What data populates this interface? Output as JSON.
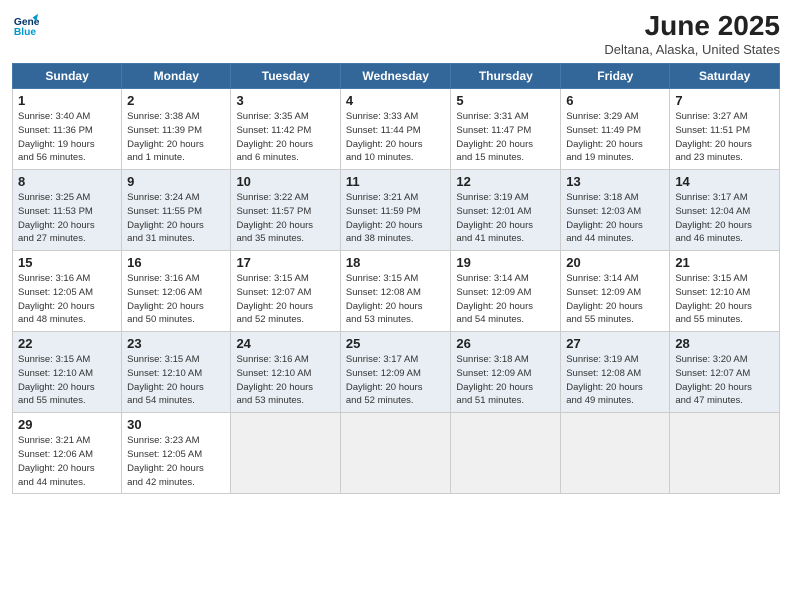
{
  "header": {
    "logo_line1": "General",
    "logo_line2": "Blue",
    "month": "June 2025",
    "location": "Deltana, Alaska, United States"
  },
  "days_of_week": [
    "Sunday",
    "Monday",
    "Tuesday",
    "Wednesday",
    "Thursday",
    "Friday",
    "Saturday"
  ],
  "weeks": [
    [
      {
        "day": "1",
        "info": "Sunrise: 3:40 AM\nSunset: 11:36 PM\nDaylight: 19 hours\nand 56 minutes."
      },
      {
        "day": "2",
        "info": "Sunrise: 3:38 AM\nSunset: 11:39 PM\nDaylight: 20 hours\nand 1 minute."
      },
      {
        "day": "3",
        "info": "Sunrise: 3:35 AM\nSunset: 11:42 PM\nDaylight: 20 hours\nand 6 minutes."
      },
      {
        "day": "4",
        "info": "Sunrise: 3:33 AM\nSunset: 11:44 PM\nDaylight: 20 hours\nand 10 minutes."
      },
      {
        "day": "5",
        "info": "Sunrise: 3:31 AM\nSunset: 11:47 PM\nDaylight: 20 hours\nand 15 minutes."
      },
      {
        "day": "6",
        "info": "Sunrise: 3:29 AM\nSunset: 11:49 PM\nDaylight: 20 hours\nand 19 minutes."
      },
      {
        "day": "7",
        "info": "Sunrise: 3:27 AM\nSunset: 11:51 PM\nDaylight: 20 hours\nand 23 minutes."
      }
    ],
    [
      {
        "day": "8",
        "info": "Sunrise: 3:25 AM\nSunset: 11:53 PM\nDaylight: 20 hours\nand 27 minutes."
      },
      {
        "day": "9",
        "info": "Sunrise: 3:24 AM\nSunset: 11:55 PM\nDaylight: 20 hours\nand 31 minutes."
      },
      {
        "day": "10",
        "info": "Sunrise: 3:22 AM\nSunset: 11:57 PM\nDaylight: 20 hours\nand 35 minutes."
      },
      {
        "day": "11",
        "info": "Sunrise: 3:21 AM\nSunset: 11:59 PM\nDaylight: 20 hours\nand 38 minutes."
      },
      {
        "day": "12",
        "info": "Sunrise: 3:19 AM\nSunset: 12:01 AM\nDaylight: 20 hours\nand 41 minutes."
      },
      {
        "day": "13",
        "info": "Sunrise: 3:18 AM\nSunset: 12:03 AM\nDaylight: 20 hours\nand 44 minutes."
      },
      {
        "day": "14",
        "info": "Sunrise: 3:17 AM\nSunset: 12:04 AM\nDaylight: 20 hours\nand 46 minutes."
      }
    ],
    [
      {
        "day": "15",
        "info": "Sunrise: 3:16 AM\nSunset: 12:05 AM\nDaylight: 20 hours\nand 48 minutes."
      },
      {
        "day": "16",
        "info": "Sunrise: 3:16 AM\nSunset: 12:06 AM\nDaylight: 20 hours\nand 50 minutes."
      },
      {
        "day": "17",
        "info": "Sunrise: 3:15 AM\nSunset: 12:07 AM\nDaylight: 20 hours\nand 52 minutes."
      },
      {
        "day": "18",
        "info": "Sunrise: 3:15 AM\nSunset: 12:08 AM\nDaylight: 20 hours\nand 53 minutes."
      },
      {
        "day": "19",
        "info": "Sunrise: 3:14 AM\nSunset: 12:09 AM\nDaylight: 20 hours\nand 54 minutes."
      },
      {
        "day": "20",
        "info": "Sunrise: 3:14 AM\nSunset: 12:09 AM\nDaylight: 20 hours\nand 55 minutes."
      },
      {
        "day": "21",
        "info": "Sunrise: 3:15 AM\nSunset: 12:10 AM\nDaylight: 20 hours\nand 55 minutes."
      }
    ],
    [
      {
        "day": "22",
        "info": "Sunrise: 3:15 AM\nSunset: 12:10 AM\nDaylight: 20 hours\nand 55 minutes."
      },
      {
        "day": "23",
        "info": "Sunrise: 3:15 AM\nSunset: 12:10 AM\nDaylight: 20 hours\nand 54 minutes."
      },
      {
        "day": "24",
        "info": "Sunrise: 3:16 AM\nSunset: 12:10 AM\nDaylight: 20 hours\nand 53 minutes."
      },
      {
        "day": "25",
        "info": "Sunrise: 3:17 AM\nSunset: 12:09 AM\nDaylight: 20 hours\nand 52 minutes."
      },
      {
        "day": "26",
        "info": "Sunrise: 3:18 AM\nSunset: 12:09 AM\nDaylight: 20 hours\nand 51 minutes."
      },
      {
        "day": "27",
        "info": "Sunrise: 3:19 AM\nSunset: 12:08 AM\nDaylight: 20 hours\nand 49 minutes."
      },
      {
        "day": "28",
        "info": "Sunrise: 3:20 AM\nSunset: 12:07 AM\nDaylight: 20 hours\nand 47 minutes."
      }
    ],
    [
      {
        "day": "29",
        "info": "Sunrise: 3:21 AM\nSunset: 12:06 AM\nDaylight: 20 hours\nand 44 minutes."
      },
      {
        "day": "30",
        "info": "Sunrise: 3:23 AM\nSunset: 12:05 AM\nDaylight: 20 hours\nand 42 minutes."
      },
      {
        "day": "",
        "info": ""
      },
      {
        "day": "",
        "info": ""
      },
      {
        "day": "",
        "info": ""
      },
      {
        "day": "",
        "info": ""
      },
      {
        "day": "",
        "info": ""
      }
    ]
  ]
}
